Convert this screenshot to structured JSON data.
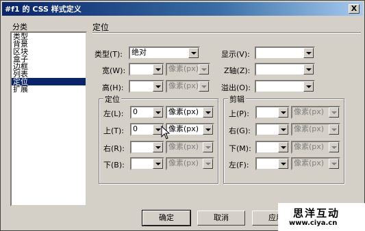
{
  "window": {
    "title": "#f1 的 CSS 样式定义",
    "close_label": "X"
  },
  "category": {
    "label": "分类",
    "items": [
      "类型",
      "背景",
      "区块",
      "盒子",
      "边框",
      "列表",
      "定位",
      "扩展"
    ],
    "selected": "定位"
  },
  "section": {
    "title": "定位"
  },
  "top": {
    "type_label": "类型(T):",
    "type_value": "绝对",
    "display_label": "显示(V):",
    "display_value": "",
    "width_label": "宽(W):",
    "width_value": "",
    "width_unit": "像素(px)",
    "zindex_label": "Z轴(Z):",
    "zindex_value": "",
    "height_label": "高(H):",
    "height_value": "",
    "height_unit": "像素(px)",
    "overflow_label": "溢出(O):",
    "overflow_value": ""
  },
  "placement": {
    "title": "定位",
    "left_label": "左(L):",
    "left_value": "0",
    "left_unit": "像素(px)",
    "top_label": "上(T):",
    "top_value": "0",
    "top_unit": "像素(px)",
    "right_label": "右(R):",
    "right_value": "",
    "right_unit": "像素(px)",
    "bottom_label": "下(B):",
    "bottom_value": "",
    "bottom_unit": "像素(px)"
  },
  "clip": {
    "title": "剪辑",
    "top_label": "上(P):",
    "top_value": "",
    "top_unit": "像素(px)",
    "right_label": "右(G):",
    "right_value": "",
    "right_unit": "像素(px)",
    "bottom_label": "下(M):",
    "bottom_value": "",
    "bottom_unit": "像素(px)",
    "left_label": "左(F):",
    "left_value": "",
    "left_unit": "像素(px)"
  },
  "buttons": {
    "ok": "确定",
    "cancel": "取消",
    "apply": "应用"
  },
  "watermark": {
    "line1": "思洋互动",
    "line2": "www.ciya.cn"
  }
}
